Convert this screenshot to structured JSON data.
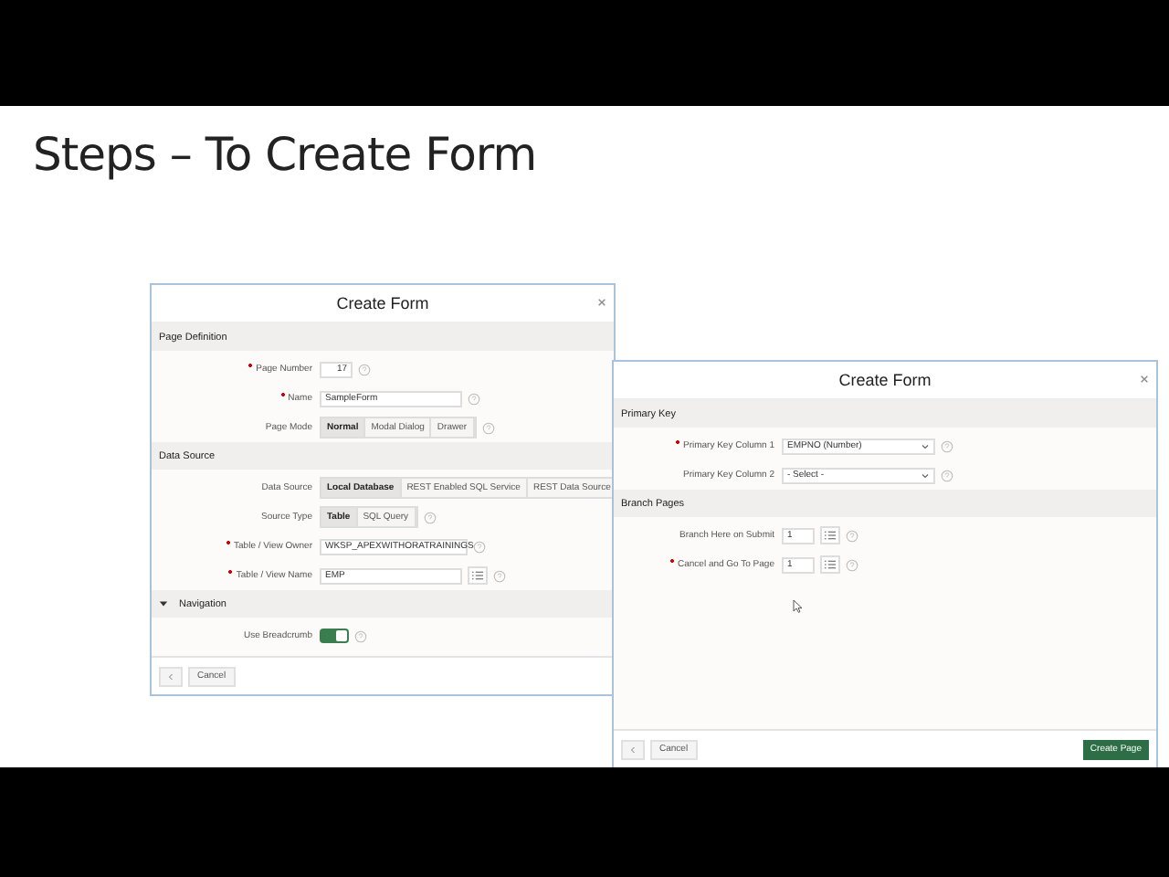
{
  "slide_title": "Steps – To Create Form",
  "dialogs": [
    {
      "title": "Create Form",
      "sections": [
        {
          "heading": "Page Definition",
          "collapsible": false,
          "fields": [
            {
              "kind": "number",
              "label": "Page Number",
              "required": true,
              "value": "17"
            },
            {
              "kind": "text",
              "label": "Name",
              "required": true,
              "value": "SampleForm"
            },
            {
              "kind": "segmented",
              "label": "Page Mode",
              "required": false,
              "options": [
                {
                  "label": "Normal",
                  "selected": true
                },
                {
                  "label": "Modal Dialog",
                  "selected": false
                },
                {
                  "label": "Drawer",
                  "selected": false
                }
              ]
            }
          ]
        },
        {
          "heading": "Data Source",
          "collapsible": false,
          "fields": [
            {
              "kind": "segmented",
              "label": "Data Source",
              "required": false,
              "options": [
                {
                  "label": "Local Database",
                  "selected": true
                },
                {
                  "label": "REST Enabled SQL Service",
                  "selected": false
                },
                {
                  "label": "REST Data Source",
                  "selected": false
                }
              ]
            },
            {
              "kind": "segmented",
              "label": "Source Type",
              "required": false,
              "options": [
                {
                  "label": "Table",
                  "selected": true
                },
                {
                  "label": "SQL Query",
                  "selected": false
                }
              ]
            },
            {
              "kind": "select",
              "label": "Table / View Owner",
              "required": true,
              "value": "WKSP_APEXWITHORATRAININGS"
            },
            {
              "kind": "lov",
              "label": "Table / View Name",
              "required": true,
              "value": "EMP"
            }
          ]
        },
        {
          "heading": "Navigation",
          "collapsible": true,
          "fields": [
            {
              "kind": "switch",
              "label": "Use Breadcrumb",
              "required": false,
              "on": true
            }
          ]
        }
      ],
      "footer": {
        "cancel": "Cancel"
      }
    },
    {
      "title": "Create Form",
      "sections": [
        {
          "heading": "Primary Key",
          "collapsible": false,
          "fields": [
            {
              "kind": "select",
              "label": "Primary Key Column 1",
              "required": true,
              "value": "EMPNO (Number)"
            },
            {
              "kind": "select",
              "label": "Primary Key Column 2",
              "required": false,
              "value": "- Select -"
            }
          ]
        },
        {
          "heading": "Branch Pages",
          "collapsible": false,
          "fields": [
            {
              "kind": "lov",
              "label": "Branch Here on Submit",
              "required": false,
              "value": "1"
            },
            {
              "kind": "lov",
              "label": "Cancel and Go To Page",
              "required": true,
              "value": "1"
            }
          ]
        }
      ],
      "footer": {
        "cancel": "Cancel",
        "primary": "Create Page"
      }
    }
  ]
}
